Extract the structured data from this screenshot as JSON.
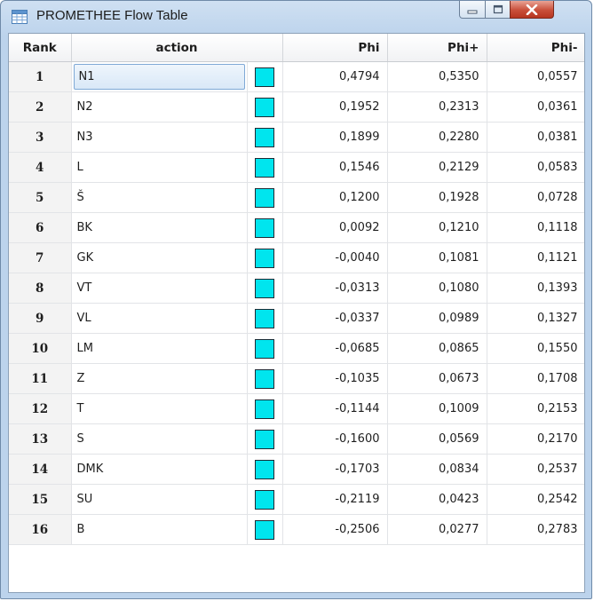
{
  "window": {
    "title": "PROMETHEE Flow Table"
  },
  "colors": {
    "swatch": "#00e5ee",
    "accent_selection": "#d9e8f7",
    "close_button": "#c94f3a"
  },
  "icons": {
    "app": "table-grid-icon",
    "minimize": "minimize-icon",
    "maximize": "maximize-icon",
    "close": "close-icon"
  },
  "table": {
    "headers": {
      "rank": "Rank",
      "action": "action",
      "phi": "Phi",
      "phi_plus": "Phi+",
      "phi_minus": "Phi-"
    },
    "rows": [
      {
        "rank": "1",
        "action": "N1",
        "phi": "0,4794",
        "phi_plus": "0,5350",
        "phi_minus": "0,0557"
      },
      {
        "rank": "2",
        "action": "N2",
        "phi": "0,1952",
        "phi_plus": "0,2313",
        "phi_minus": "0,0361"
      },
      {
        "rank": "3",
        "action": "N3",
        "phi": "0,1899",
        "phi_plus": "0,2280",
        "phi_minus": "0,0381"
      },
      {
        "rank": "4",
        "action": "L",
        "phi": "0,1546",
        "phi_plus": "0,2129",
        "phi_minus": "0,0583"
      },
      {
        "rank": "5",
        "action": "Š",
        "phi": "0,1200",
        "phi_plus": "0,1928",
        "phi_minus": "0,0728"
      },
      {
        "rank": "6",
        "action": "BK",
        "phi": "0,0092",
        "phi_plus": "0,1210",
        "phi_minus": "0,1118"
      },
      {
        "rank": "7",
        "action": "GK",
        "phi": "-0,0040",
        "phi_plus": "0,1081",
        "phi_minus": "0,1121"
      },
      {
        "rank": "8",
        "action": "VT",
        "phi": "-0,0313",
        "phi_plus": "0,1080",
        "phi_minus": "0,1393"
      },
      {
        "rank": "9",
        "action": "VL",
        "phi": "-0,0337",
        "phi_plus": "0,0989",
        "phi_minus": "0,1327"
      },
      {
        "rank": "10",
        "action": "LM",
        "phi": "-0,0685",
        "phi_plus": "0,0865",
        "phi_minus": "0,1550"
      },
      {
        "rank": "11",
        "action": "Z",
        "phi": "-0,1035",
        "phi_plus": "0,0673",
        "phi_minus": "0,1708"
      },
      {
        "rank": "12",
        "action": "T",
        "phi": "-0,1144",
        "phi_plus": "0,1009",
        "phi_minus": "0,2153"
      },
      {
        "rank": "13",
        "action": "S",
        "phi": "-0,1600",
        "phi_plus": "0,0569",
        "phi_minus": "0,2170"
      },
      {
        "rank": "14",
        "action": "DMK",
        "phi": "-0,1703",
        "phi_plus": "0,0834",
        "phi_minus": "0,2537"
      },
      {
        "rank": "15",
        "action": "SU",
        "phi": "-0,2119",
        "phi_plus": "0,0423",
        "phi_minus": "0,2542"
      },
      {
        "rank": "16",
        "action": "B",
        "phi": "-0,2506",
        "phi_plus": "0,0277",
        "phi_minus": "0,2783"
      }
    ]
  }
}
